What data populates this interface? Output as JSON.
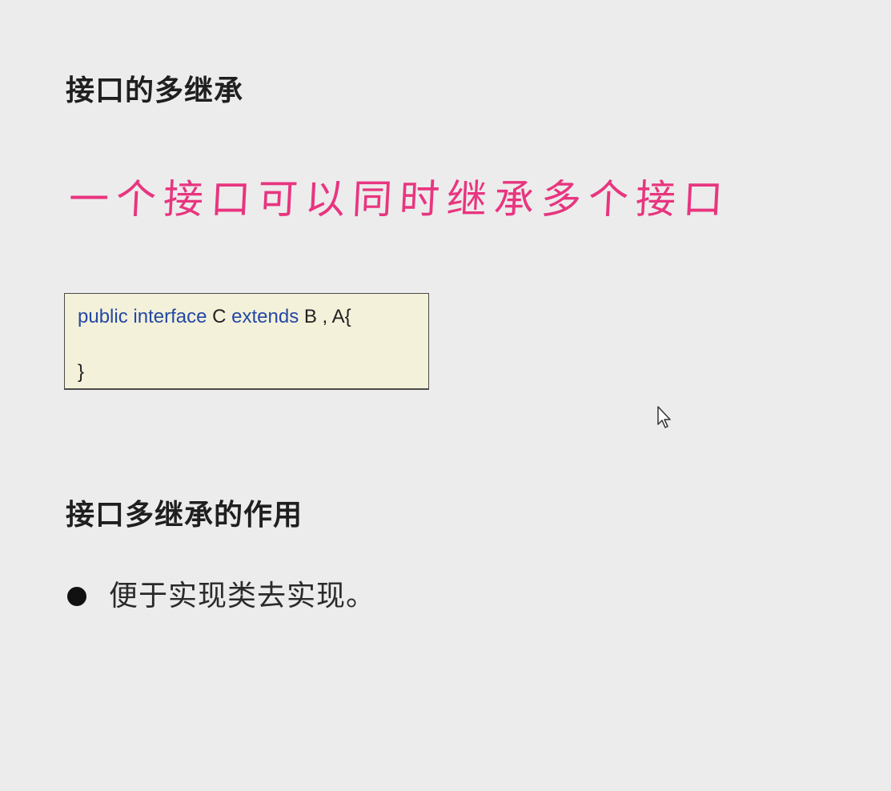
{
  "section1": {
    "title": "接口的多继承",
    "handwritten_note": "一个接口可以同时继承多个接口",
    "handwritten_color": "#e8357f"
  },
  "code": {
    "kw_public": "public",
    "kw_interface": "interface",
    "name_c": "C",
    "kw_extends": "extends",
    "parents": "B , A{",
    "close": "}",
    "keyword_color": "#2448a5",
    "background_color": "#f3f1d9"
  },
  "section2": {
    "title": "接口多继承的作用",
    "bullets": [
      "便于实现类去实现。"
    ]
  },
  "cursor": {
    "icon": "mouse-pointer-icon"
  }
}
